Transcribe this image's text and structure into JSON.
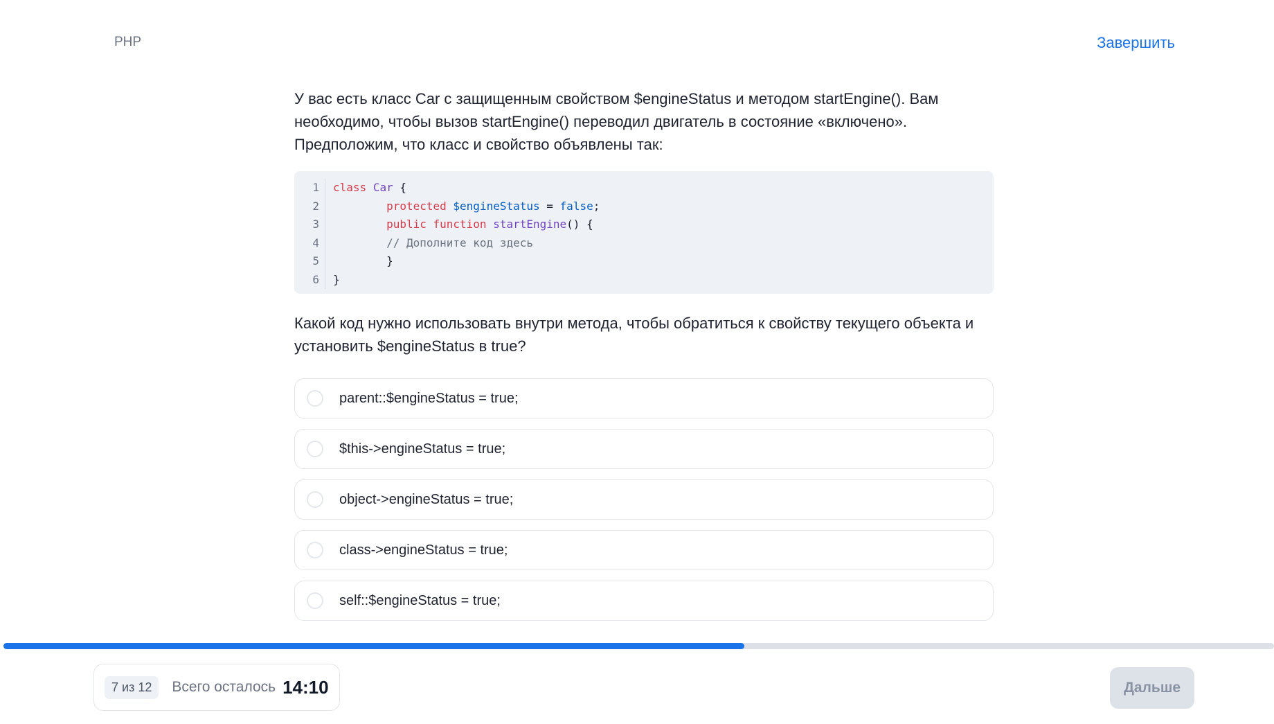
{
  "header": {
    "topic": "PHP",
    "finish_label": "Завершить"
  },
  "question": {
    "intro": "У вас есть класс Car с защищенным свойством $engineStatus и методом startEngine(). Вам необходимо, чтобы вызов startEngine() переводил двигатель в состояние «включено». Предположим, что класс и свойство объявлены так:",
    "code_lines": [
      {
        "num": "1"
      },
      {
        "num": "2"
      },
      {
        "num": "3"
      },
      {
        "num": "4"
      },
      {
        "num": "5"
      },
      {
        "num": "6"
      }
    ],
    "code": {
      "l1_kw": "class",
      "l1_name": "Car",
      "l1_rest": " {",
      "l2_kw": "protected",
      "l2_var": "$engineStatus",
      "l2_eq": " = ",
      "l2_bool": "false",
      "l2_end": ";",
      "l3_kw1": "public",
      "l3_kw2": "function",
      "l3_fn": "startEngine",
      "l3_rest": "() {",
      "l4_comment": "// Дополните код здесь",
      "l5": "}",
      "l6": "}"
    },
    "prompt": "Какой код нужно использовать внутри метода, чтобы обратиться к свойству текущего объекта и установить $engineStatus в true?",
    "options": [
      {
        "label": "parent::$engineStatus = true;"
      },
      {
        "label": "$this->engineStatus = true;"
      },
      {
        "label": "object->engineStatus = true;"
      },
      {
        "label": "class->engineStatus = true;"
      },
      {
        "label": "self::$engineStatus = true;"
      }
    ]
  },
  "progress": {
    "fraction": 0.583
  },
  "footer": {
    "counter": "7 из 12",
    "remaining_label": "Всего осталось",
    "timer": "14:10",
    "next_label": "Дальше"
  },
  "colors": {
    "accent": "#1a73e8",
    "code_bg": "#eef2f7",
    "disabled_button": "#dde2e9"
  }
}
